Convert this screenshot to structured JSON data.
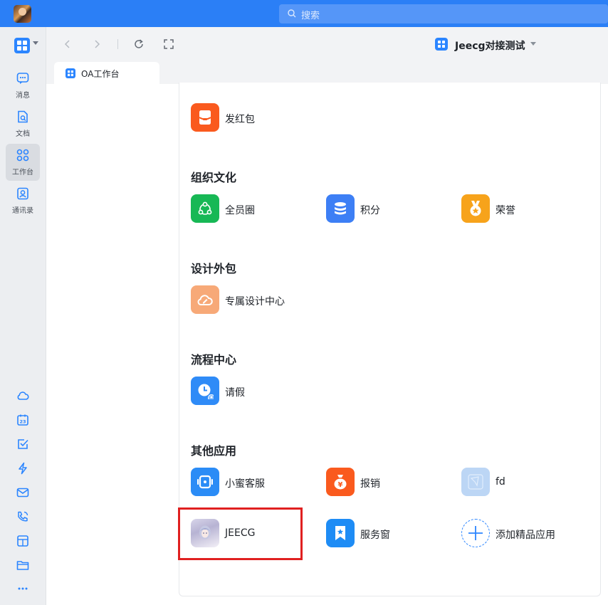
{
  "search": {
    "placeholder": "搜索"
  },
  "sidebar": {
    "items": [
      {
        "label": "消息",
        "icon": "message-icon"
      },
      {
        "label": "文档",
        "icon": "document-icon"
      },
      {
        "label": "工作台",
        "icon": "workbench-icon",
        "active": true
      },
      {
        "label": "通讯录",
        "icon": "contacts-icon"
      }
    ],
    "tools": [
      "cloud-icon",
      "calendar-icon",
      "todo-icon",
      "flash-icon",
      "mail-icon",
      "phone-icon",
      "report-icon",
      "folder-icon",
      "more-icon"
    ],
    "calendar_day": "23"
  },
  "toolbar": {
    "org_name": "Jeecg对接测试"
  },
  "tab": {
    "label": "OA工作台"
  },
  "sections": [
    {
      "title": "",
      "apps": [
        {
          "label": "发红包",
          "color": "#fa5a1e"
        }
      ]
    },
    {
      "title": "组织文化",
      "apps": [
        {
          "label": "全员圈",
          "color": "#17b855"
        },
        {
          "label": "积分",
          "color": "#3d7ff5"
        },
        {
          "label": "荣誉",
          "color": "#f7a31b"
        }
      ]
    },
    {
      "title": "设计外包",
      "apps": [
        {
          "label": "专属设计中心",
          "color": "#f7a978"
        }
      ]
    },
    {
      "title": "流程中心",
      "apps": [
        {
          "label": "请假",
          "color": "#2f8bf7"
        }
      ]
    },
    {
      "title": "其他应用",
      "apps": [
        {
          "label": "小蜜客服",
          "color": "#2b8cf6"
        },
        {
          "label": "报销",
          "color": "#fa5a1e"
        },
        {
          "label": "fd",
          "color": "#bcd6f5"
        },
        {
          "label": "JEECG",
          "color": "#e9e6f2"
        },
        {
          "label": "服务窗",
          "color": "#1e8cf5"
        },
        {
          "label": "添加精品应用",
          "color": "#2b85ff"
        }
      ]
    }
  ],
  "colors": {
    "topbar": "#2b7ff6",
    "accent": "#2b85ff",
    "highlight": "#e02020"
  }
}
